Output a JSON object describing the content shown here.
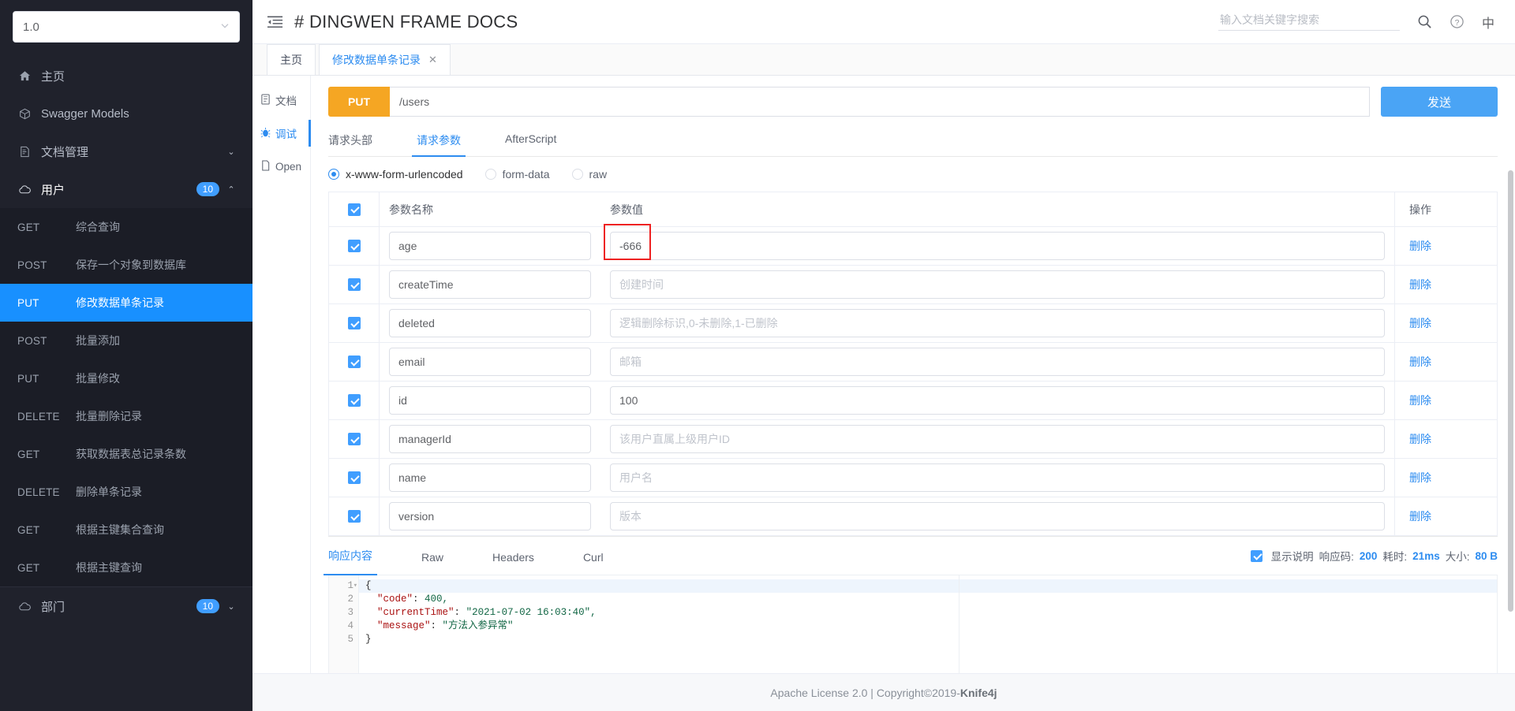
{
  "sidebar": {
    "version_select": {
      "value": "1.0"
    },
    "nav": [
      {
        "icon": "home-icon",
        "label": "主页"
      },
      {
        "icon": "cube-icon",
        "label": "Swagger Models"
      },
      {
        "icon": "doc-icon",
        "label": "文档管理",
        "arrow": "⌄"
      },
      {
        "icon": "cloud-icon",
        "label": "用户",
        "badge": "10",
        "arrow": "⌃"
      }
    ],
    "submenu": [
      {
        "method": "GET",
        "name": "综合查询"
      },
      {
        "method": "POST",
        "name": "保存一个对象到数据库"
      },
      {
        "method": "PUT",
        "name": "修改数据单条记录",
        "selected": true
      },
      {
        "method": "POST",
        "name": "批量添加"
      },
      {
        "method": "PUT",
        "name": "批量修改"
      },
      {
        "method": "DELETE",
        "name": "批量删除记录"
      },
      {
        "method": "GET",
        "name": "获取数据表总记录条数"
      },
      {
        "method": "DELETE",
        "name": "删除单条记录"
      },
      {
        "method": "GET",
        "name": "根据主键集合查询"
      },
      {
        "method": "GET",
        "name": "根据主键查询"
      }
    ],
    "nav_bottom": [
      {
        "icon": "cloud-icon",
        "label": "部门",
        "badge": "10",
        "arrow": "⌄"
      }
    ]
  },
  "header": {
    "collapse_icon": "collapse-menu-icon",
    "title": "# DINGWEN FRAME DOCS",
    "search_placeholder": "输入文档关键字搜索",
    "search_value": "",
    "search_icon": "search-icon",
    "help_icon": "help-circle-icon",
    "lang_label": "中"
  },
  "tabs": [
    {
      "label": "主页",
      "active": false,
      "closable": false
    },
    {
      "label": "修改数据单条记录",
      "active": true,
      "closable": true,
      "close_icon": "✕"
    }
  ],
  "left_nav": [
    {
      "icon": "document-icon",
      "label": "文档",
      "active": false
    },
    {
      "icon": "bug-icon",
      "label": "调试",
      "active": true
    },
    {
      "icon": "file-icon",
      "label": "Open",
      "active": false
    }
  ],
  "request": {
    "method": "PUT",
    "url": "/users",
    "send_label": "发送",
    "tabs": [
      {
        "label": "请求头部",
        "active": false
      },
      {
        "label": "请求参数",
        "active": true
      },
      {
        "label": "AfterScript",
        "active": false
      }
    ],
    "body_types": [
      {
        "label": "x-www-form-urlencoded",
        "selected": true
      },
      {
        "label": "form-data",
        "selected": false
      },
      {
        "label": "raw",
        "selected": false
      }
    ],
    "table": {
      "headers": {
        "name": "参数名称",
        "value": "参数值",
        "op": "操作"
      },
      "delete_label": "删除",
      "rows": [
        {
          "checked": true,
          "name": "age",
          "value": "-666",
          "placeholder": "",
          "highlight": true
        },
        {
          "checked": true,
          "name": "createTime",
          "value": "",
          "placeholder": "创建时间"
        },
        {
          "checked": true,
          "name": "deleted",
          "value": "",
          "placeholder": "逻辑删除标识,0-未删除,1-已删除"
        },
        {
          "checked": true,
          "name": "email",
          "value": "",
          "placeholder": "邮箱"
        },
        {
          "checked": true,
          "name": "id",
          "value": "100",
          "placeholder": ""
        },
        {
          "checked": true,
          "name": "managerId",
          "value": "",
          "placeholder": "该用户直属上级用户ID"
        },
        {
          "checked": true,
          "name": "name",
          "value": "",
          "placeholder": "用户名"
        },
        {
          "checked": true,
          "name": "version",
          "value": "",
          "placeholder": "版本"
        }
      ]
    }
  },
  "response": {
    "tabs": [
      {
        "label": "响应内容",
        "active": true
      },
      {
        "label": "Raw",
        "active": false
      },
      {
        "label": "Headers",
        "active": false
      },
      {
        "label": "Curl",
        "active": false
      }
    ],
    "show_desc_label": "显示说明",
    "show_desc_checked": true,
    "meta": [
      {
        "key": "响应码:",
        "value": "200"
      },
      {
        "key": "耗时:",
        "value": "21ms"
      },
      {
        "key": "大小:",
        "value": "80 B"
      }
    ],
    "code_lines": [
      "1",
      "2",
      "3",
      "4",
      "5"
    ],
    "body": {
      "line1": "{",
      "line2_key": "\"code\"",
      "line2_val": "400,",
      "line3_key": "\"currentTime\"",
      "line3_val": "\"2021-07-02 16:03:40\",",
      "line4_key": "\"message\"",
      "line4_val": "\"方法入参异常\"",
      "line5": "}"
    }
  },
  "footer": {
    "text_before": "Apache License 2.0 | Copyright ",
    "copyright_icon": "©",
    "text_mid": " 2019-",
    "brand": "Knife4j"
  },
  "colors": {
    "accent": "#2d8cf0",
    "selected_nav": "#1890ff",
    "method_put": "#f5a623",
    "send_button": "#4aa4f5",
    "highlight_box": "#ee2222",
    "sidebar_bg": "#20222c"
  }
}
